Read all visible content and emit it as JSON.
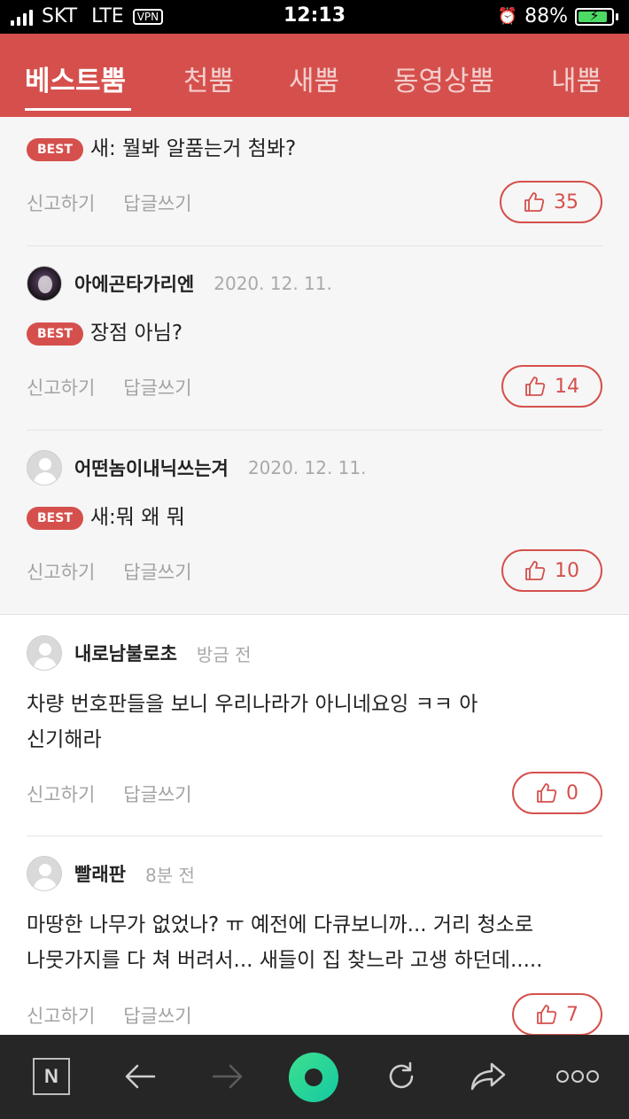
{
  "status_bar": {
    "carrier": "SKT",
    "network": "LTE",
    "vpn": "VPN",
    "time": "12:13",
    "battery_text": "88%",
    "battery_level": 0.88
  },
  "tabs": [
    {
      "label": "베스트뿜",
      "active": true
    },
    {
      "label": "천뿜",
      "active": false
    },
    {
      "label": "새뿜",
      "active": false
    },
    {
      "label": "동영상뿜",
      "active": false
    },
    {
      "label": "내뿜",
      "active": false
    }
  ],
  "common": {
    "report_label": "신고하기",
    "reply_label": "답글쓰기",
    "best_badge": "BEST"
  },
  "best_comments": [
    {
      "text": "새: 뭘봐 알품는거 첨봐?",
      "likes": "35"
    },
    {
      "nickname": "아에곤타가리엔",
      "date": "2020. 12. 11.",
      "text": "장점 아님?",
      "likes": "14"
    },
    {
      "nickname": "어떤놈이내닉쓰는겨",
      "date": "2020. 12. 11.",
      "text": "새:뭐 왜 뭐",
      "likes": "10"
    }
  ],
  "comments": [
    {
      "nickname": "내로남불로초",
      "date": "방금 전",
      "text_line1": "차량 번호판들을 보니 우리나라가 아니네요잉 ㅋㅋ 아",
      "text_line2": "신기해라",
      "likes": "0"
    },
    {
      "nickname": "빨래판",
      "date": "8분 전",
      "text_line1": "마땅한 나무가 없었나? ㅠ 예전에 다큐보니까... 거리 청소로",
      "text_line2": "나뭇가지를 다 쳐 버려서... 새들이 집 찾느라 고생 하던데.....",
      "likes": "7"
    }
  ],
  "bottom_nav": {
    "n_label": "N",
    "icons": [
      "naver-n-icon",
      "back-arrow-icon",
      "forward-arrow-icon",
      "home-green-icon",
      "refresh-icon",
      "share-icon",
      "more-icon"
    ]
  },
  "colors": {
    "accent": "#d5504c",
    "best_bg": "#f6f6f6",
    "nav_bg": "#262626"
  }
}
